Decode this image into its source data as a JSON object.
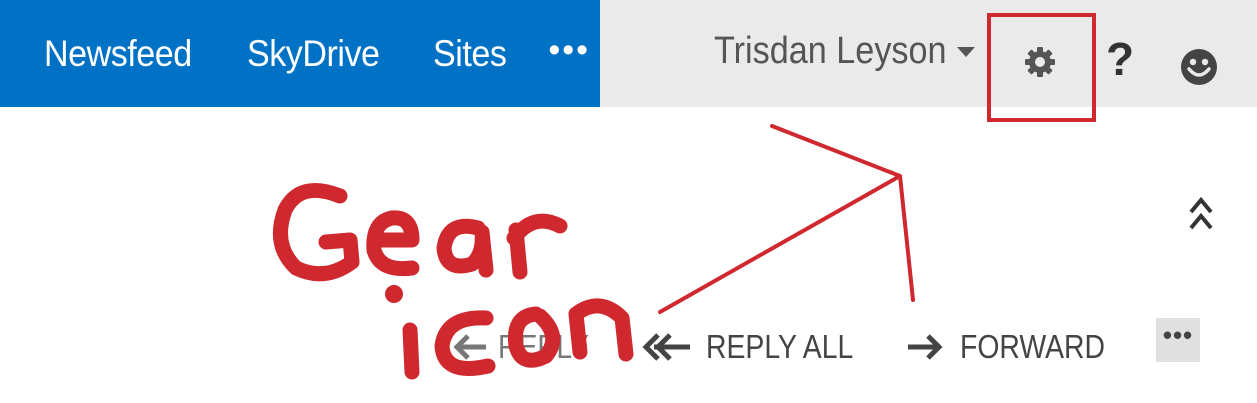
{
  "nav": {
    "links": [
      "Newsfeed",
      "SkyDrive",
      "Sites"
    ],
    "more_label": "•••"
  },
  "header": {
    "user_name": "Trisdan Leyson",
    "help_label": "?"
  },
  "actions": {
    "reply_label": "REPLY",
    "reply_all_label": "REPLY ALL",
    "forward_label": "FORWARD",
    "more_label": "•••"
  },
  "annotation": {
    "handwritten_text": "Gear icon",
    "color": "#d0282f"
  },
  "icons": [
    "gear-icon",
    "help-icon",
    "smiley-icon",
    "collapse-chevron-icon",
    "reply-icon",
    "reply-all-icon",
    "forward-arrow-icon"
  ],
  "colors": {
    "nav_blue": "#0072c6",
    "topbar_gray": "#eaeaea",
    "annotation_red": "#d0282f"
  }
}
